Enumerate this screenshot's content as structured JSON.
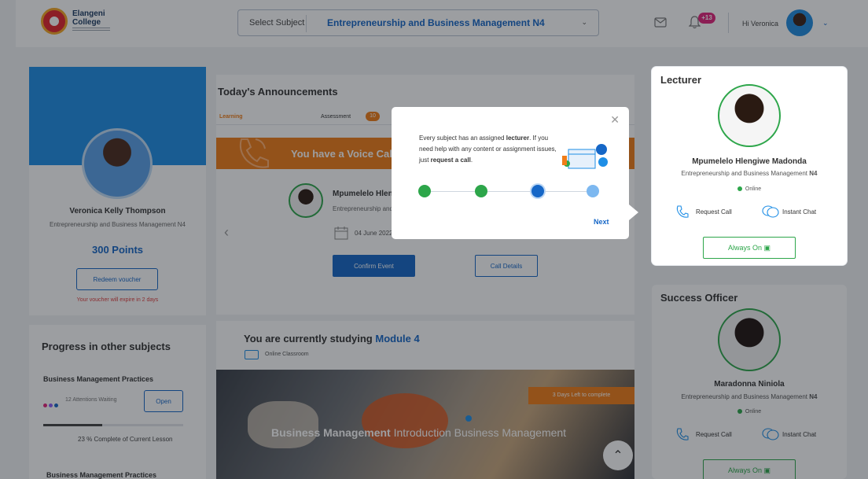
{
  "header": {
    "logo_name": "Elangeni College",
    "subject_label": "Select Subject",
    "subject_value": "Entrepreneurship and Business Management N4",
    "notification_count": "+13",
    "greeting": "Hi Veronica"
  },
  "profile": {
    "name": "Veronica Kelly Thompson",
    "subject": "Entrepreneurship and Business Management N4",
    "points": "300 Points",
    "redeem_label": "Redeem voucher",
    "voucher_note": "Your voucher will expire in 2 days"
  },
  "progress": {
    "title": "Progress in other subjects",
    "items": [
      {
        "title": "Business Management Practices",
        "waiting": "12 Attentions Waiting",
        "open_label": "Open",
        "percent_text": "23 % Complete of Current Lesson",
        "percent_value": 0.42
      },
      {
        "title": "Business Management Practices"
      }
    ],
    "dot_colors": [
      "#e2237a",
      "#8b5cf6",
      "#1667c7"
    ]
  },
  "announcements": {
    "title": "Today's Announcements",
    "tab_learning": "Learning",
    "tab_assessment": "Assessment",
    "tab_assessment_badge": "10",
    "banner": "You have a Voice Call",
    "lecturer_name": "Mpumelelo Hlengiwe Madonda",
    "lecturer_subject": "Entrepreneurship and Business Management N4",
    "date": "04 June 2022",
    "confirm_label": "Confirm Event",
    "details_label": "Call Details"
  },
  "module": {
    "title_prefix": "You are currently studying",
    "title_module": "Module 4",
    "subtitle": "Online Classroom",
    "days_left": "3 Days Left to complete",
    "caption_bold": "Business Management",
    "caption_rest": "Introduction Business Management"
  },
  "lecturer": {
    "heading": "Lecturer",
    "name": "Mpumelelo Hlengiwe Madonda",
    "subject_prefix": "Entrepreneurship and Business Management",
    "subject_level": "N4",
    "status": "Online",
    "request_call": "Request Call",
    "instant_chat": "Instant Chat",
    "always_on": "Always On"
  },
  "success_officer": {
    "heading": "Success Officer",
    "name": "Maradonna Niniola",
    "subject_prefix": "Entrepreneurship and Business Management",
    "subject_level": "N4",
    "status": "Online",
    "request_call": "Request Call",
    "instant_chat": "Instant Chat",
    "always_on": "Always On"
  },
  "tooltip": {
    "text_1": "Every subject has an assigned ",
    "text_lecturer": "lecturer",
    "text_2": ". If you need help with any content or assignment issues, just ",
    "text_request": "request a call",
    "text_3": ".",
    "next_label": "Next",
    "steps": [
      "complete",
      "complete",
      "current",
      "upcoming"
    ]
  },
  "colors": {
    "accent": "#1667c7",
    "orange": "#f07d18",
    "green": "#2da64a",
    "pink": "#e2237a"
  }
}
